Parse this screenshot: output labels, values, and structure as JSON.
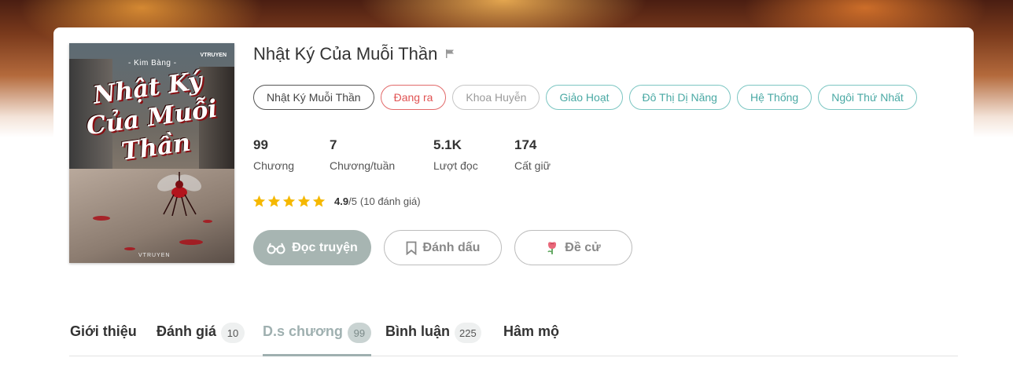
{
  "book": {
    "title": "Nhật Ký Của Muỗi Thần",
    "cover": {
      "author_label": "- Kim Bàng -",
      "title_text": "Nhật Ký Của Muỗi Thần",
      "brand_top": "VTRUYEN",
      "brand_bottom": "VTRUYEN"
    }
  },
  "tags": [
    {
      "label": "Nhật Ký Muỗi Thần",
      "style": "dark"
    },
    {
      "label": "Đang ra",
      "style": "red"
    },
    {
      "label": "Khoa Huyễn",
      "style": "grey"
    },
    {
      "label": "Giảo Hoạt",
      "style": "teal"
    },
    {
      "label": "Đô Thị Dị Năng",
      "style": "teal"
    },
    {
      "label": "Hệ Thống",
      "style": "teal"
    },
    {
      "label": "Ngôi Thứ Nhất",
      "style": "teal"
    }
  ],
  "stats": [
    {
      "value": "99",
      "label": "Chương"
    },
    {
      "value": "7",
      "label": "Chương/tuần"
    },
    {
      "value": "5.1K",
      "label": "Lượt đọc"
    },
    {
      "value": "174",
      "label": "Cất giữ"
    }
  ],
  "rating": {
    "stars": 5,
    "score": "4.9",
    "out_of": "/5",
    "count_text": "(10 đánh giá)"
  },
  "buttons": {
    "read": "Đọc truyện",
    "bookmark": "Đánh dấu",
    "vote": "Đề cử"
  },
  "tabs": [
    {
      "label": "Giới thiệu",
      "badge": null,
      "active": false
    },
    {
      "label": "Đánh giá",
      "badge": "10",
      "active": false
    },
    {
      "label": "D.s chương",
      "badge": "99",
      "active": true
    },
    {
      "label": "Bình luận",
      "badge": "225",
      "active": false
    },
    {
      "label": "Hâm mộ",
      "badge": null,
      "active": false
    }
  ],
  "colors": {
    "accent_teal": "#4aa9a4",
    "status_red": "#e05353",
    "read_button": "#a7b5b2",
    "star": "#f5b800"
  }
}
